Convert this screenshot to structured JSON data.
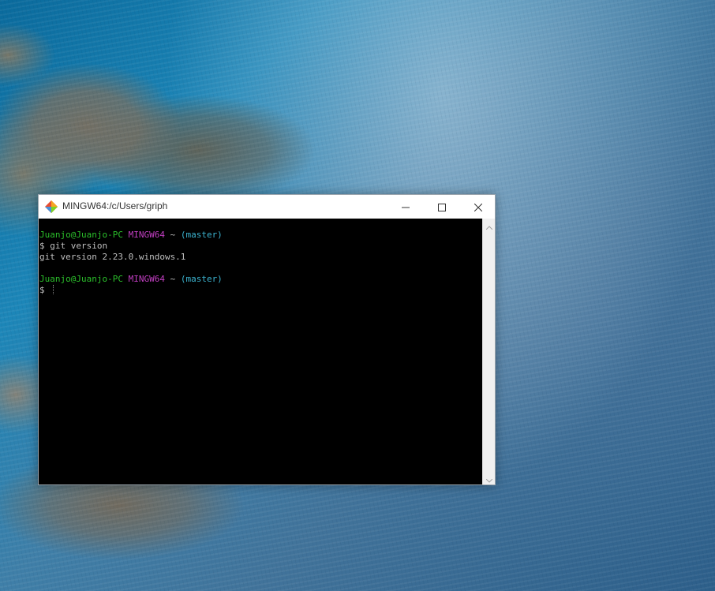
{
  "desktop": {
    "wallpaper": "sea-and-rocks-aerial"
  },
  "window": {
    "title": "MINGW64:/c/Users/griph",
    "icon": "git-diamond-icon",
    "controls": {
      "minimize": "minimize-icon",
      "maximize": "maximize-icon",
      "close": "close-icon"
    }
  },
  "terminal": {
    "prompt1": {
      "user_host": "Juanjo@Juanjo-PC",
      "env": "MINGW64",
      "path": "~",
      "branch": "(master)"
    },
    "command1": "$ git version",
    "output1": "git version 2.23.0.windows.1",
    "prompt2": {
      "user_host": "Juanjo@Juanjo-PC",
      "env": "MINGW64",
      "path": "~",
      "branch": "(master)"
    },
    "command2": "$ "
  },
  "colors": {
    "prompt_user": "#2bc02b",
    "prompt_env": "#c33fc3",
    "prompt_branch": "#3cb4d0",
    "terminal_bg": "#000000",
    "terminal_text": "#c0c0c0"
  }
}
